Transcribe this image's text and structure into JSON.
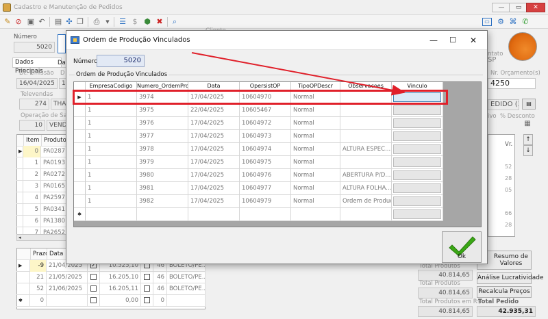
{
  "main": {
    "title": "Cadastro e Manutenção de Pedidos",
    "numero_label": "Número",
    "numero_value": "5020",
    "cliente_label": "Cliente",
    "tabs": [
      "Dados Principais",
      "Da"
    ],
    "dt_emissao_label": "Dt. Emissão",
    "dt_emissao_value": "16/04/2025",
    "dt_d_label": "D",
    "dt_d_value": "1",
    "televendas_label": "Televendas",
    "televendas_code": "274",
    "televendas_name": "THA",
    "operacao_label": "Operação de Saída",
    "operacao_code": "10",
    "operacao_name": "VEND",
    "contato_label": "ntato",
    "nr_orcamento_label": "Nr. Orçamento(s)",
    "nr_orcamento_value": "4250",
    "sp_value": "SP",
    "pedido_value": "EDIDO (3",
    "ivo_label": "ivo",
    "desconto_label": "% Desconto",
    "vr_label": "Vr.",
    "items_headers": [
      "Item",
      "Produto"
    ],
    "items": [
      {
        "item": "0",
        "produto": "PA0287",
        "vr": ""
      },
      {
        "item": "1",
        "produto": "PA0193",
        "vr": "52"
      },
      {
        "item": "2",
        "produto": "PA0272",
        "vr": "28"
      },
      {
        "item": "3",
        "produto": "PA0165",
        "vr": "05"
      },
      {
        "item": "4",
        "produto": "PA2597",
        "vr": ""
      },
      {
        "item": "5",
        "produto": "PA0341",
        "vr": "66"
      },
      {
        "item": "6",
        "produto": "PA1380",
        "vr": "28"
      },
      {
        "item": "7",
        "produto": "PA2652",
        "vr": ""
      }
    ],
    "prazo_headers": [
      "Prazo",
      "Data"
    ],
    "parcelas": [
      {
        "prazo": "-9",
        "data": "21/04/2025",
        "checked": true,
        "valor": "10.525,10",
        "num": "46",
        "forma": "BOLETO/PE..."
      },
      {
        "prazo": "21",
        "data": "21/05/2025",
        "checked": false,
        "valor": "16.205,10",
        "num": "46",
        "forma": "BOLETO/PE..."
      },
      {
        "prazo": "52",
        "data": "21/06/2025",
        "checked": false,
        "valor": "16.205,11",
        "num": "46",
        "forma": "BOLETO/PE..."
      },
      {
        "prazo": "0",
        "data": "",
        "checked": false,
        "valor": "0,00",
        "num": "0",
        "forma": ""
      }
    ],
    "total_produtos_top_label": "Total Produtos",
    "total_produtos_top_value": "40.814,65",
    "total_produtos_label": "Total Produtos",
    "total_produtos_value": "40.814,65",
    "total_produtos_rs_label": "Total Produtos em R$",
    "total_produtos_rs_value": "40.814,65",
    "total_pedido_label": "Total Pedido",
    "total_pedido_value": "42.935,31",
    "resumo_label": "Resumo de Valores",
    "analise_label": "Análise Lucratividade",
    "recalcula_label": "Recalcula Preços"
  },
  "dialog": {
    "title": "Ordem de Produção Vinculados",
    "numero_label": "Número",
    "numero_value": "5020",
    "group_label": "Ordem de Produção Vinculados",
    "columns": [
      "EmpresaCodigo",
      "Numero_OrdemProd",
      "Data",
      "OpersistOP",
      "TipoOPDescr",
      "Observacoes",
      "Vinculo"
    ],
    "rows": [
      {
        "empresa": "1",
        "numero": "3974",
        "data": "17/04/2025",
        "opersist": "10604970",
        "tipo": "Normal",
        "obs": ""
      },
      {
        "empresa": "1",
        "numero": "3975",
        "data": "22/04/2025",
        "opersist": "10605467",
        "tipo": "Normal",
        "obs": ""
      },
      {
        "empresa": "1",
        "numero": "3976",
        "data": "17/04/2025",
        "opersist": "10604972",
        "tipo": "Normal",
        "obs": ""
      },
      {
        "empresa": "1",
        "numero": "3977",
        "data": "17/04/2025",
        "opersist": "10604973",
        "tipo": "Normal",
        "obs": ""
      },
      {
        "empresa": "1",
        "numero": "3978",
        "data": "17/04/2025",
        "opersist": "10604974",
        "tipo": "Normal",
        "obs": "ALTURA ESPEC..."
      },
      {
        "empresa": "1",
        "numero": "3979",
        "data": "17/04/2025",
        "opersist": "10604975",
        "tipo": "Normal",
        "obs": ""
      },
      {
        "empresa": "1",
        "numero": "3980",
        "data": "17/04/2025",
        "opersist": "10604976",
        "tipo": "Normal",
        "obs": "ABERTURA P/D..."
      },
      {
        "empresa": "1",
        "numero": "3981",
        "data": "17/04/2025",
        "opersist": "10604977",
        "tipo": "Normal",
        "obs": "ALTURA FOLHA..."
      },
      {
        "empresa": "1",
        "numero": "3982",
        "data": "17/04/2025",
        "opersist": "10604979",
        "tipo": "Normal",
        "obs": "Ordem de Produç..."
      }
    ],
    "ok_label": "Ok",
    "colors": {
      "highlight": "#e0202a",
      "arrow": "#e0202a",
      "ok_check": "#3aa815"
    }
  }
}
